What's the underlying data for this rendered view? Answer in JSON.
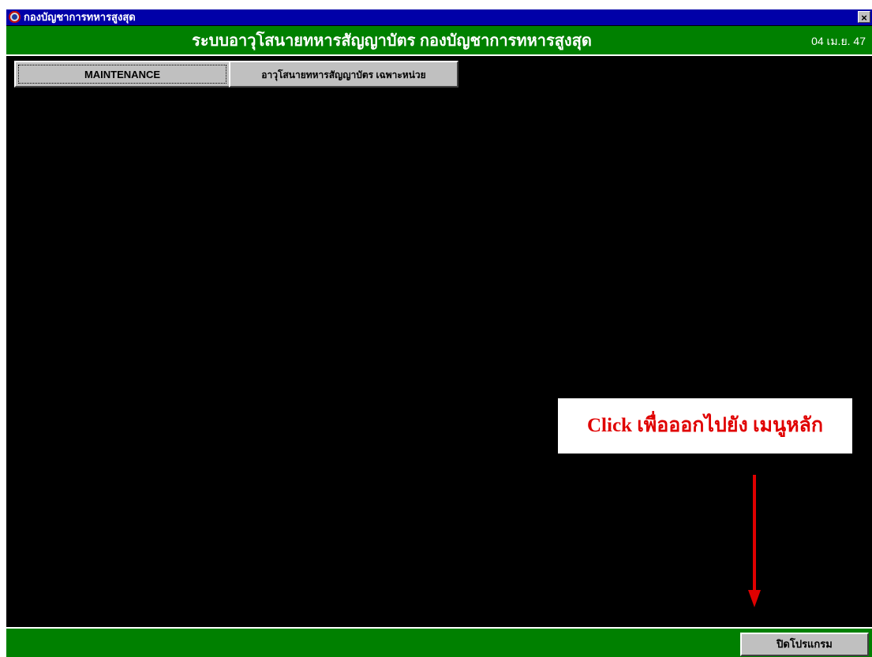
{
  "window": {
    "title": "กองบัญชาการทหารสูงสุด",
    "icon": "app-emblem-icon",
    "close_label": "×"
  },
  "header": {
    "system_title": "ระบบอาวุโสนายทหารสัญญาบัตร กองบัญชาการทหารสูงสุด",
    "date": "04 เม.ย. 47"
  },
  "menu": {
    "items": [
      {
        "label": "MAINTENANCE"
      },
      {
        "label": "อาวุโสนายทหารสัญญาบัตร เฉพาะหน่วย"
      }
    ]
  },
  "callout": {
    "text": "Click เพื่อออกไปยัง เมนูหลัก"
  },
  "footer": {
    "exit_label": "ปิดโปรแกรม"
  },
  "colors": {
    "titlebar": "#0000a8",
    "header": "#008000",
    "background": "#000000",
    "button": "#c0c0c0",
    "annotation": "#e00000"
  }
}
